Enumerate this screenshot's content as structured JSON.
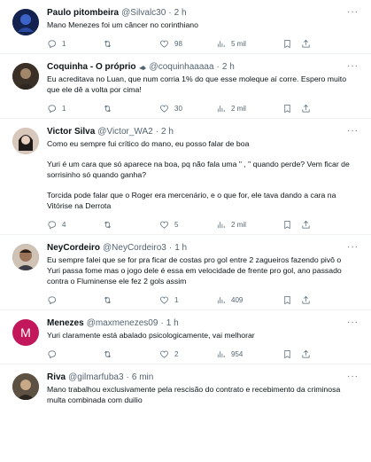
{
  "tweets": [
    {
      "name": "Paulo pitombeira",
      "handle": "@Silvalc30",
      "time": "2 h",
      "lines": [
        "Mano Menezes foi um câncer no corinthiano"
      ],
      "replies": "1",
      "retweets": "",
      "likes": "98",
      "views": "5 mil",
      "avatar_color": "#1a2a6c"
    },
    {
      "name": "Coquinha - O próprio",
      "handle": "@coquinhaaaaa",
      "time": "2 h",
      "lines": [
        "Eu acreditava no Luan, que num corria 1% do que esse moleque aí corre. Espero muito que ele dê a volta por cima!"
      ],
      "replies": "1",
      "retweets": "",
      "likes": "30",
      "views": "2 mil",
      "avatar_color": "#6b5a44"
    },
    {
      "name": "Victor Silva",
      "handle": "@Victor_WA2",
      "time": "2 h",
      "lines": [
        "Como eu sempre fui crítico do mano, eu posso falar de boa",
        "Yuri é um cara que só aparece na boa, pq não fala uma \" , \" quando perde? Vem ficar de sorrisinho só quando ganha?",
        "Torcida pode falar que o Roger era mercenário, e o que for, ele tava dando a cara na Vitórise na Derrota"
      ],
      "replies": "4",
      "retweets": "",
      "likes": "5",
      "views": "2 mil",
      "avatar_color": "#c9b7a8"
    },
    {
      "name": "NeyCordeiro",
      "handle": "@NeyCordeiro3",
      "time": "1 h",
      "lines": [
        "Eu sempre falei que se for pra ficar de costas pro gol entre 2 zagueiros fazendo pivô o Yuri passa fome mas o jogo dele é essa em velocidade de frente pro gol, ano passado contra o Fluminense ele fez 2 gols assim"
      ],
      "replies": "",
      "retweets": "",
      "likes": "1",
      "views": "409",
      "avatar_color": "#8a6d55"
    },
    {
      "name": "Menezes",
      "handle": "@maxmenezes09",
      "time": "1 h",
      "lines": [
        "Yuri claramente está abalado psicologicamente, vai melhorar"
      ],
      "replies": "",
      "retweets": "",
      "likes": "2",
      "views": "954",
      "avatar_color": "#c2185b",
      "avatar_letter": "M"
    },
    {
      "name": "Riva",
      "handle": "@gilmarfuba3",
      "time": "6 min",
      "lines": [
        "Mano trabalhou exclusivamente pela rescisão do contrato e recebimento da criminosa multa combinada com duilio"
      ],
      "replies": "",
      "retweets": "",
      "likes": "",
      "views": "",
      "avatar_color": "#7a6a52"
    }
  ]
}
